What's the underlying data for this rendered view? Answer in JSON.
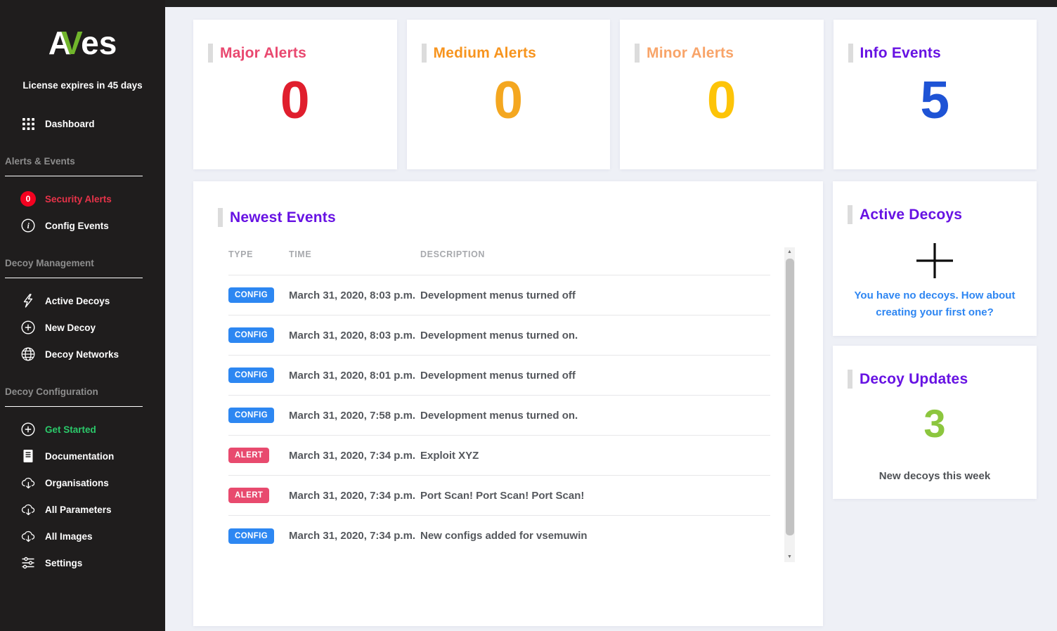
{
  "sidebar": {
    "logo": {
      "prefix": "A",
      "accent": "V",
      "suffix": "es"
    },
    "license_text": "License expires in 45 days",
    "dashboard": {
      "label": "Dashboard"
    },
    "sections": [
      {
        "title": "Alerts & Events",
        "items": [
          {
            "label": "Security Alerts",
            "icon": "alert-badge",
            "badge": "0",
            "label_color": "#e73349"
          },
          {
            "label": "Config Events",
            "icon": "info"
          }
        ]
      },
      {
        "title": "Decoy Management",
        "items": [
          {
            "label": "Active Decoys",
            "icon": "lightning"
          },
          {
            "label": "New Decoy",
            "icon": "plus-circle"
          },
          {
            "label": "Decoy Networks",
            "icon": "globe"
          }
        ]
      },
      {
        "title": "Decoy Configuration",
        "items": [
          {
            "label": "Get Started",
            "icon": "plus-circle",
            "label_color": "#2bc96a"
          },
          {
            "label": "Documentation",
            "icon": "document"
          },
          {
            "label": "Organisations",
            "icon": "cloud-download"
          },
          {
            "label": "All Parameters",
            "icon": "cloud-download"
          },
          {
            "label": "All Images",
            "icon": "cloud-download"
          },
          {
            "label": "Settings",
            "icon": "sliders"
          }
        ]
      }
    ]
  },
  "stats": [
    {
      "title": "Major Alerts",
      "value": "0",
      "title_color": "#e9486f",
      "value_color": "#e01e2d"
    },
    {
      "title": "Medium Alerts",
      "value": "0",
      "title_color": "#f7941e",
      "value_color": "#f4a720"
    },
    {
      "title": "Minor Alerts",
      "value": "0",
      "title_color": "#f8a469",
      "value_color": "#fdc408"
    },
    {
      "title": "Info Events",
      "value": "5",
      "title_color": "#6712e3",
      "value_color": "#1e53d5"
    }
  ],
  "events": {
    "title": "Newest Events",
    "columns": [
      "TYPE",
      "TIME",
      "DESCRIPTION"
    ],
    "rows": [
      {
        "type": "CONFIG",
        "time": "March 31, 2020, 8:03 p.m.",
        "description": "Development menus turned off"
      },
      {
        "type": "CONFIG",
        "time": "March 31, 2020, 8:03 p.m.",
        "description": "Development menus turned on."
      },
      {
        "type": "CONFIG",
        "time": "March 31, 2020, 8:01 p.m.",
        "description": "Development menus turned off"
      },
      {
        "type": "CONFIG",
        "time": "March 31, 2020, 7:58 p.m.",
        "description": "Development menus turned on."
      },
      {
        "type": "ALERT",
        "time": "March 31, 2020, 7:34 p.m.",
        "description": "Exploit XYZ"
      },
      {
        "type": "ALERT",
        "time": "March 31, 2020, 7:34 p.m.",
        "description": "Port Scan! Port Scan! Port Scan!"
      },
      {
        "type": "CONFIG",
        "time": "March 31, 2020, 7:34 p.m.",
        "description": "New configs added for vsemuwin"
      }
    ]
  },
  "active_decoys": {
    "title": "Active Decoys",
    "empty_text": "You have no decoys. How about creating your first one?"
  },
  "decoy_updates": {
    "title": "Decoy Updates",
    "value": "3",
    "caption": "New decoys this week"
  },
  "colors": {
    "accent_purple": "#6712e3",
    "link_blue": "#2e86f2",
    "config_badge": "#2d87f2",
    "alert_badge": "#e84a6e",
    "updates_green": "#8cc63e",
    "logo_green": "#71b52c",
    "security_red": "#e73349",
    "badge_red": "#f30220",
    "sidebar_bg": "#1f1d1d"
  }
}
